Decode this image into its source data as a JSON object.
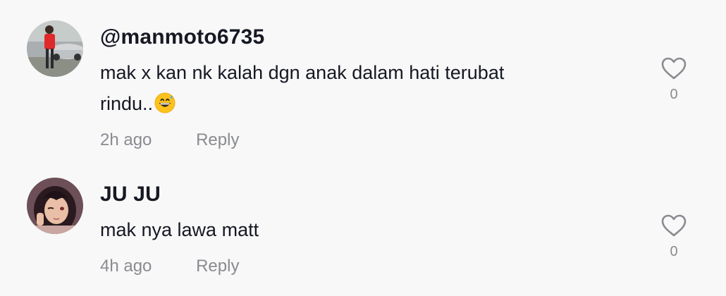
{
  "comments": [
    {
      "username": "@manmoto6735",
      "text_line1": "mak x kan nk kalah dgn anak dalam hati terubat",
      "text_line2": "rindu..",
      "emoji": "grinning-face-with-sweat-emoji",
      "time": "2h ago",
      "reply_label": "Reply",
      "like_count": "0"
    },
    {
      "username": "JU JU",
      "text_line1": "mak nya lawa matt",
      "time": "4h ago",
      "reply_label": "Reply",
      "like_count": "0"
    }
  ],
  "colors": {
    "background": "#f8f8f8",
    "primary_text": "#161823",
    "secondary_text": "#8a8b91"
  }
}
